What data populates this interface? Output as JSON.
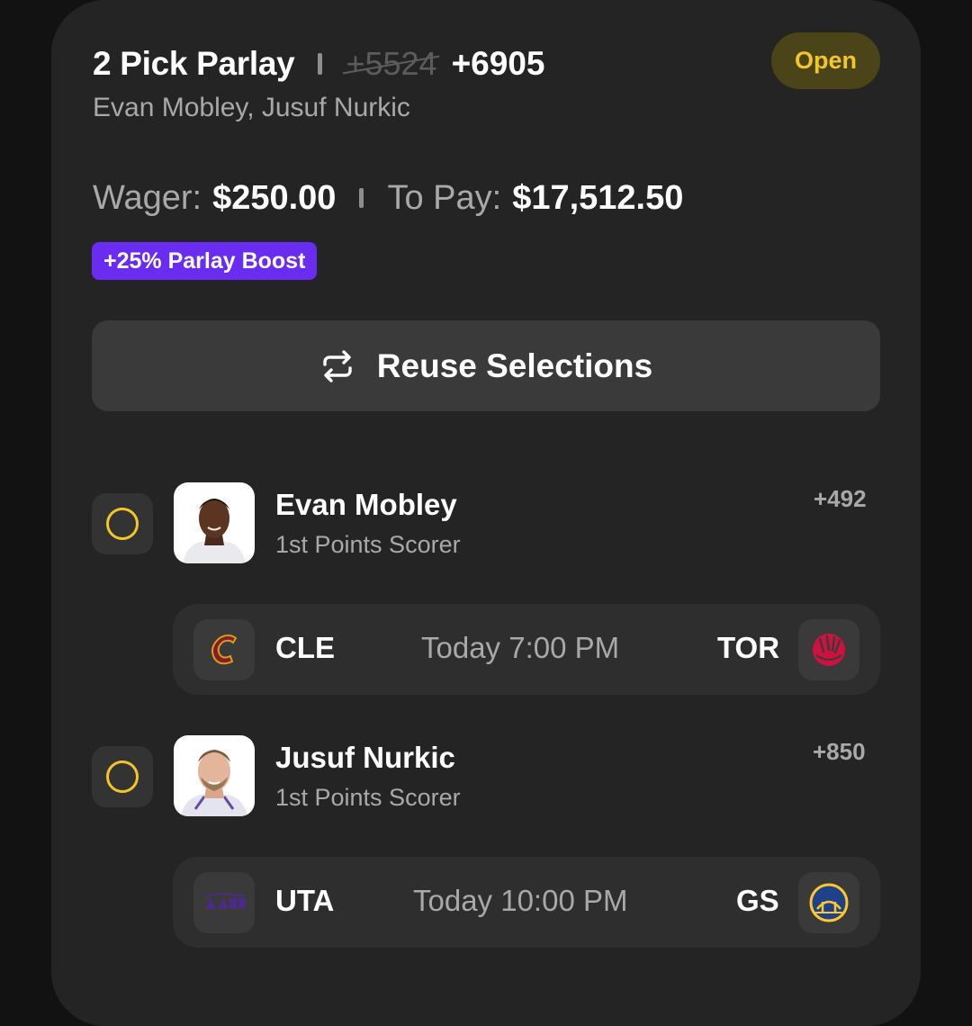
{
  "bet": {
    "title": "2 Pick Parlay",
    "old_odds": "+5524",
    "new_odds": "+6905",
    "players_summary": "Evan Mobley, Jusuf Nurkic",
    "status": "Open",
    "wager_label": "Wager:",
    "wager_value": "$250.00",
    "payout_label": "To Pay:",
    "payout_value": "$17,512.50",
    "boost_label": "+25% Parlay Boost",
    "reuse_label": "Reuse Selections"
  },
  "legs": [
    {
      "player": "Evan Mobley",
      "market": "1st Points Scorer",
      "odds": "+492",
      "away": "CLE",
      "home": "TOR",
      "time": "Today 7:00 PM",
      "away_logo": "cavaliers-logo",
      "home_logo": "raptors-logo"
    },
    {
      "player": "Jusuf Nurkic",
      "market": "1st Points Scorer",
      "odds": "+850",
      "away": "UTA",
      "home": "GS",
      "time": "Today 10:00 PM",
      "away_logo": "jazz-logo",
      "home_logo": "warriors-logo"
    }
  ],
  "colors": {
    "background": "#121212",
    "card": "#242424",
    "accent_yellow": "#f2c52b",
    "boost_purple": "#6a2cf0"
  }
}
